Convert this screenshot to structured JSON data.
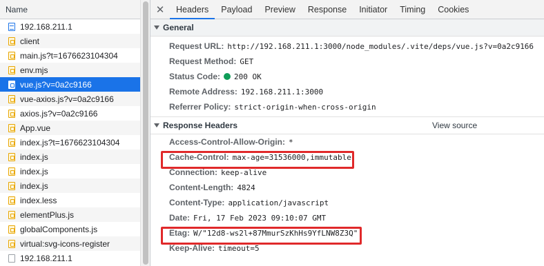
{
  "list": {
    "header": "Name",
    "items": [
      {
        "name": "192.168.211.1",
        "icon": "doc-icon"
      },
      {
        "name": "client",
        "icon": "js-icon"
      },
      {
        "name": "main.js?t=1676623104304",
        "icon": "js-icon"
      },
      {
        "name": "env.mjs",
        "icon": "js-icon"
      },
      {
        "name": "vue.js?v=0a2c9166",
        "icon": "js-icon",
        "selected": true
      },
      {
        "name": "vue-axios.js?v=0a2c9166",
        "icon": "js-icon"
      },
      {
        "name": "axios.js?v=0a2c9166",
        "icon": "js-icon"
      },
      {
        "name": "App.vue",
        "icon": "js-icon"
      },
      {
        "name": "index.js?t=1676623104304",
        "icon": "js-icon"
      },
      {
        "name": "index.js",
        "icon": "js-icon"
      },
      {
        "name": "index.js",
        "icon": "js-icon"
      },
      {
        "name": "index.js",
        "icon": "js-icon"
      },
      {
        "name": "index.less",
        "icon": "js-icon"
      },
      {
        "name": "elementPlus.js",
        "icon": "js-icon"
      },
      {
        "name": "globalComponents.js",
        "icon": "js-icon"
      },
      {
        "name": "virtual:svg-icons-register",
        "icon": "js-icon"
      },
      {
        "name": "192.168.211.1",
        "icon": "other-icon"
      }
    ]
  },
  "tabs": [
    "Headers",
    "Payload",
    "Preview",
    "Response",
    "Initiator",
    "Timing",
    "Cookies"
  ],
  "close_glyph": "✕",
  "general": {
    "title": "General",
    "rows": [
      {
        "name": "Request URL:",
        "value": "http://192.168.211.1:3000/node_modules/.vite/deps/vue.js?v=0a2c9166"
      },
      {
        "name": "Request Method:",
        "value": "GET"
      },
      {
        "name": "Status Code:",
        "value": "200 OK",
        "status_dot": true
      },
      {
        "name": "Remote Address:",
        "value": "192.168.211.1:3000"
      },
      {
        "name": "Referrer Policy:",
        "value": "strict-origin-when-cross-origin"
      }
    ]
  },
  "response": {
    "title": "Response Headers",
    "view_source": "View source",
    "rows": [
      {
        "name": "Access-Control-Allow-Origin:",
        "value": "*"
      },
      {
        "name": "Cache-Control:",
        "value": "max-age=31536000,immutable",
        "highlight": true
      },
      {
        "name": "Connection:",
        "value": "keep-alive"
      },
      {
        "name": "Content-Length:",
        "value": "4824"
      },
      {
        "name": "Content-Type:",
        "value": "application/javascript"
      },
      {
        "name": "Date:",
        "value": "Fri, 17 Feb 2023 09:10:07 GMT"
      },
      {
        "name": "Etag:",
        "value": "W/\"12d8-ws2l+87MmurSzKhHs9YfLNW8Z3Q\"",
        "highlight": true
      },
      {
        "name": "Keep-Alive:",
        "value": "timeout=5"
      }
    ]
  },
  "colors": {
    "accent": "#1a73e8",
    "highlight_box": "#e0292a",
    "status_ok": "#0f9d58"
  }
}
